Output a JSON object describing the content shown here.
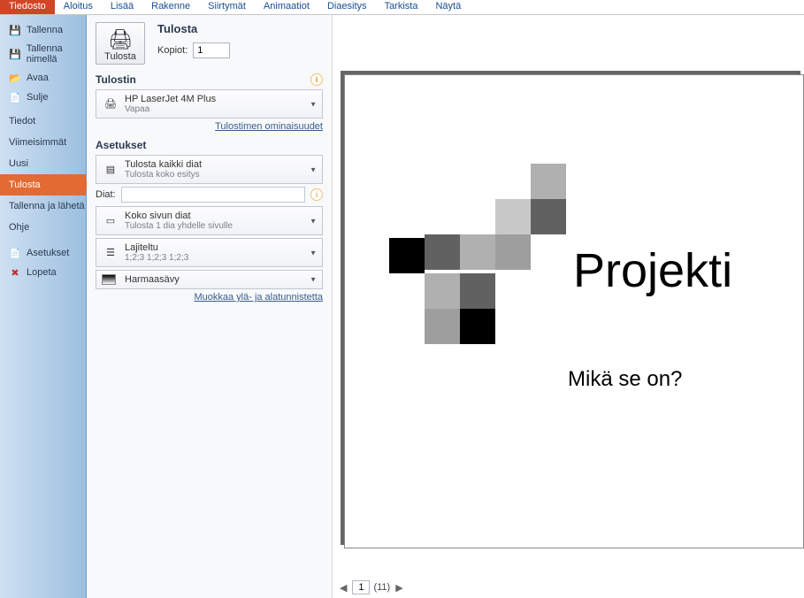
{
  "ribbon": {
    "tabs": [
      "Tiedosto",
      "Aloitus",
      "Lisää",
      "Rakenne",
      "Siirtymät",
      "Animaatiot",
      "Diaesitys",
      "Tarkista",
      "Näytä"
    ],
    "active_index": 0
  },
  "sidebar": {
    "top": [
      {
        "label": "Tallenna",
        "icon": "💾"
      },
      {
        "label": "Tallenna nimellä",
        "icon": "💾"
      },
      {
        "label": "Avaa",
        "icon": "📂"
      },
      {
        "label": "Sulje",
        "icon": "📄"
      }
    ],
    "mid": [
      "Tiedot",
      "Viimeisimmät",
      "Uusi",
      "Tulosta",
      "Tallenna ja lähetä",
      "Ohje"
    ],
    "mid_active_index": 3,
    "bottom": [
      {
        "label": "Asetukset",
        "icon": "📄"
      },
      {
        "label": "Lopeta",
        "icon": "✖"
      }
    ]
  },
  "print": {
    "title": "Tulosta",
    "button_label": "Tulosta",
    "copies_label": "Kopiot:",
    "copies_value": "1"
  },
  "printer": {
    "heading": "Tulostin",
    "name": "HP LaserJet 4M Plus",
    "status": "Vapaa",
    "props_link": "Tulostimen ominaisuudet"
  },
  "settings": {
    "heading": "Asetukset",
    "what": {
      "line1": "Tulosta kaikki diat",
      "line2": "Tulosta koko esitys"
    },
    "slides_label": "Diat:",
    "layout": {
      "line1": "Koko sivun diat",
      "line2": "Tulosta 1 dia yhdelle sivulle"
    },
    "collate": {
      "line1": "Lajiteltu",
      "line2": "1;2;3   1;2;3   1;2;3"
    },
    "color": {
      "line1": "Harmaasävy"
    },
    "hf_link": "Muokkaa ylä- ja alatunnistetta"
  },
  "preview": {
    "title": "Projekti",
    "subtitle": "Mikä se on?",
    "page_current": "1",
    "page_total": "(11)"
  }
}
